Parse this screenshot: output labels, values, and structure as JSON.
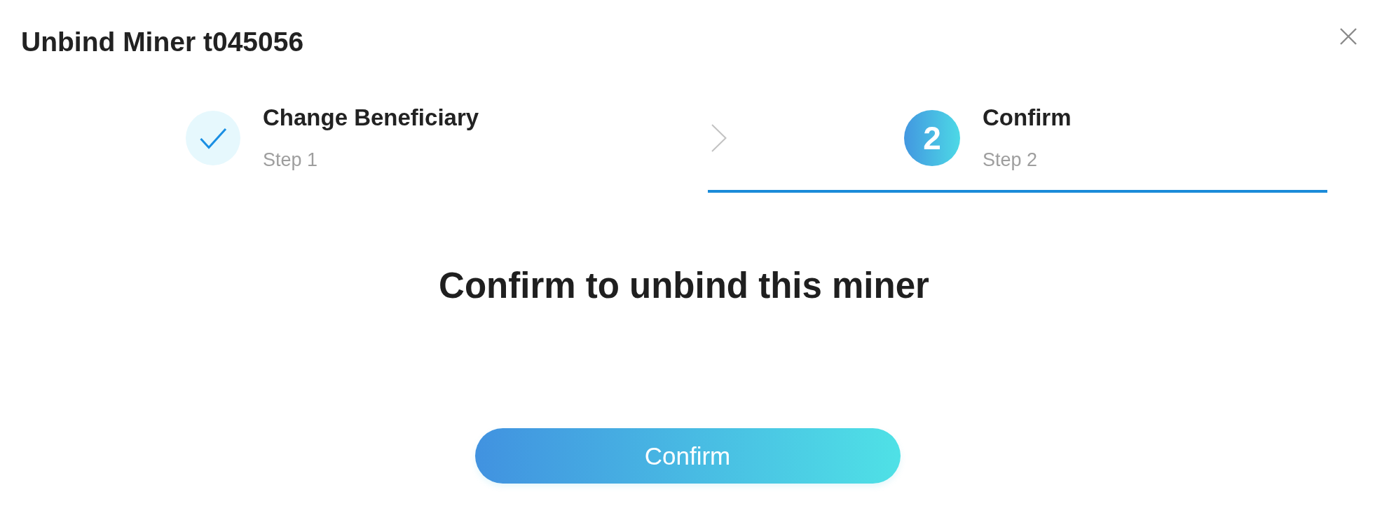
{
  "dialog": {
    "title": "Unbind Miner t045056"
  },
  "steps": [
    {
      "kind": "done",
      "title": "Change Beneficiary",
      "subtitle": "Step 1",
      "selected": false
    },
    {
      "kind": "number",
      "number": "2",
      "title": "Confirm",
      "subtitle": "Step 2",
      "selected": true
    }
  ],
  "message": "Confirm to unbind this miner",
  "confirm_button": {
    "label": "Confirm"
  }
}
